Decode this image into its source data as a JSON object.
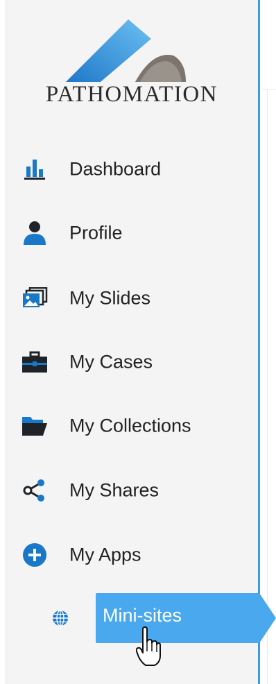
{
  "brand": {
    "name": "PATHOMATION",
    "logo_icon": "pathomation-logo"
  },
  "nav": {
    "items": [
      {
        "label": "Dashboard",
        "icon": "bar-chart-icon"
      },
      {
        "label": "Profile",
        "icon": "user-icon"
      },
      {
        "label": "My Slides",
        "icon": "slides-icon"
      },
      {
        "label": "My Cases",
        "icon": "briefcase-icon"
      },
      {
        "label": "My Collections",
        "icon": "folder-open-icon"
      },
      {
        "label": "My Shares",
        "icon": "share-icon"
      },
      {
        "label": "My Apps",
        "icon": "plus-circle-icon"
      }
    ],
    "sub_items": [
      {
        "label": "Mini-sites",
        "icon": "globe-icon",
        "active": true
      }
    ]
  },
  "colors": {
    "accent": "#4aa8ee",
    "icon_blue": "#1a78c9",
    "icon_dark": "#1f2327",
    "sidebar_bg": "#f4f4f4",
    "divider": "#3d9be0"
  }
}
